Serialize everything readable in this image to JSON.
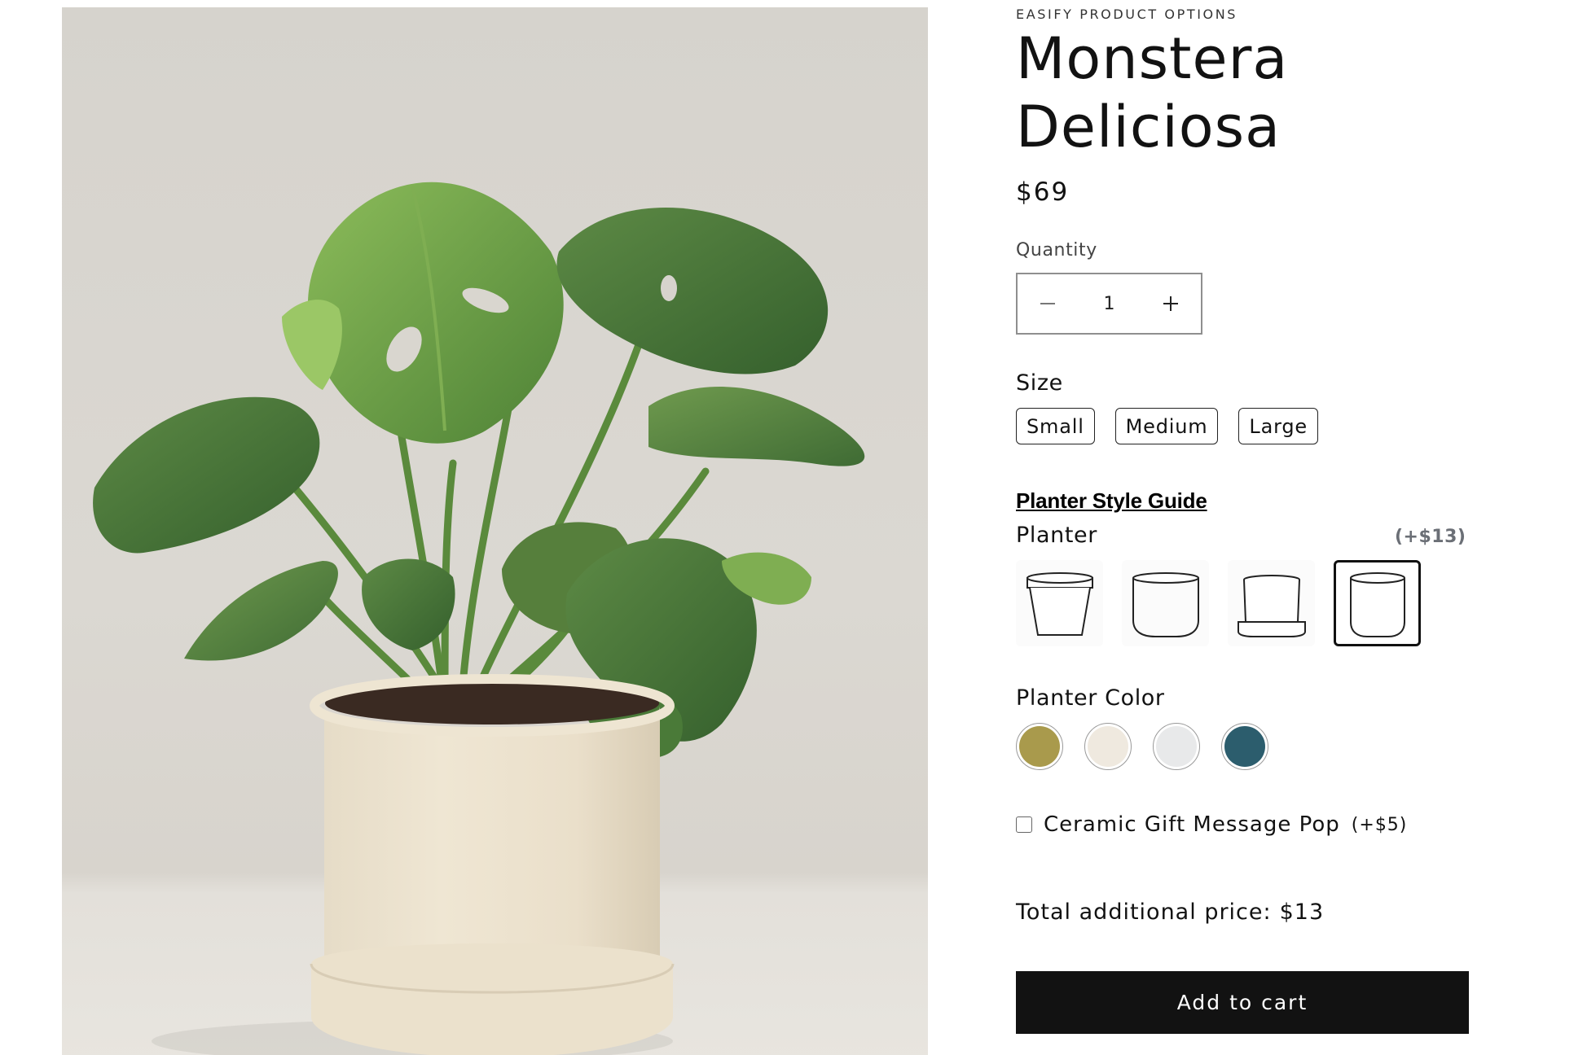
{
  "product": {
    "vendor": "EASIFY PRODUCT OPTIONS",
    "title_line1": "Monstera",
    "title_line2": "Deliciosa",
    "price": "$69",
    "image_icon": "product-photo"
  },
  "quantity": {
    "label": "Quantity",
    "value": "1",
    "decrease_icon": "minus-icon",
    "increase_icon": "plus-icon"
  },
  "size": {
    "label": "Size",
    "options": [
      "Small",
      "Medium",
      "Large"
    ]
  },
  "planter": {
    "guide_link": "Planter Style Guide",
    "label": "Planter",
    "added_price": "(+$13)",
    "options": [
      "planter-tapered-icon",
      "planter-round-icon",
      "planter-saucer-icon",
      "planter-cylinder-icon"
    ],
    "selected_index": 3
  },
  "planter_color": {
    "label": "Planter Color",
    "colors": [
      "#a99a4c",
      "#efe9df",
      "#e8e9ea",
      "#2c5d6d"
    ]
  },
  "gift": {
    "label": "Ceramic Gift Message Pop",
    "added_price": "(+$5)",
    "checked": false
  },
  "total": {
    "label": "Total additional price:",
    "value": "$13"
  },
  "cart": {
    "button_label": "Add to cart"
  }
}
